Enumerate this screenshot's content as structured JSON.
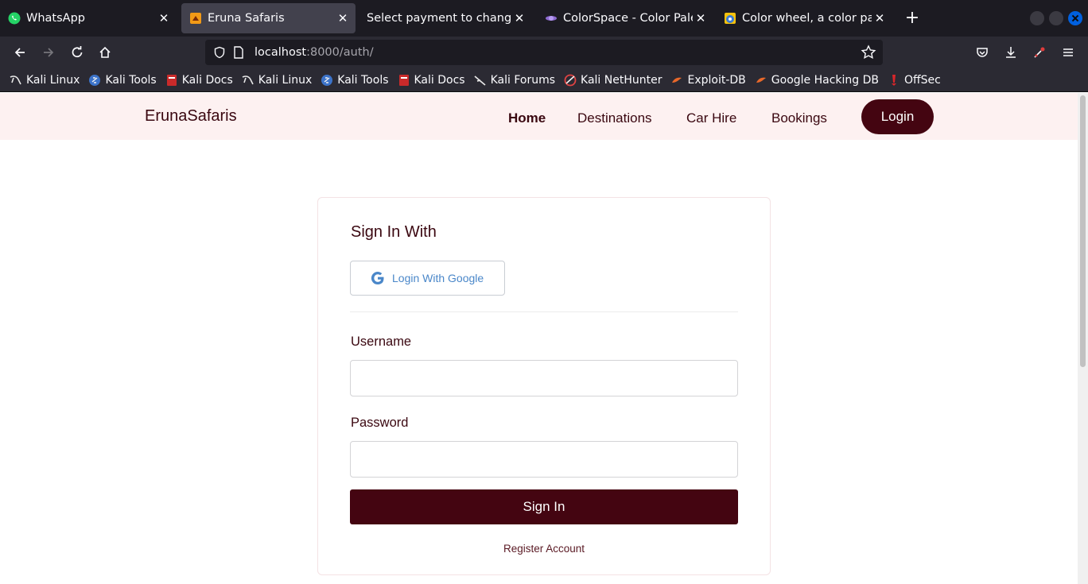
{
  "browser": {
    "tabs": [
      {
        "title": "WhatsApp",
        "icon": "whatsapp-icon",
        "active": false
      },
      {
        "title": "Eruna Safaris",
        "icon": "eruna-favicon",
        "active": true
      },
      {
        "title": "Select payment to change | D",
        "icon": "",
        "active": false
      },
      {
        "title": "ColorSpace - Color Palett",
        "icon": "colorspace-icon",
        "active": false
      },
      {
        "title": "Color wheel, a color palet",
        "icon": "color-wheel-icon",
        "active": false
      }
    ],
    "url": {
      "host": "localhost",
      "rest": ":8000/auth/"
    },
    "bookmarks": [
      {
        "label": "Kali Linux",
        "icon": "kali-dragon-icon"
      },
      {
        "label": "Kali Tools",
        "icon": "kali-tools-icon"
      },
      {
        "label": "Kali Docs",
        "icon": "kali-docs-icon"
      },
      {
        "label": "Kali Linux",
        "icon": "kali-dragon-icon"
      },
      {
        "label": "Kali Tools",
        "icon": "kali-tools-icon"
      },
      {
        "label": "Kali Docs",
        "icon": "kali-docs-icon"
      },
      {
        "label": "Kali Forums",
        "icon": "kali-dragon-icon"
      },
      {
        "label": "Kali NetHunter",
        "icon": "nethunter-icon"
      },
      {
        "label": "Exploit-DB",
        "icon": "exploit-db-icon"
      },
      {
        "label": "Google Hacking DB",
        "icon": "ghdb-icon"
      },
      {
        "label": "OffSec",
        "icon": "offsec-icon"
      }
    ]
  },
  "site": {
    "brand": "ErunaSafaris",
    "nav": {
      "home": "Home",
      "destinations": "Destinations",
      "car_hire": "Car Hire",
      "bookings": "Bookings",
      "login": "Login"
    }
  },
  "auth": {
    "title": "Sign In With",
    "google_button": "Login With Google",
    "username_label": "Username",
    "username_value": "",
    "password_label": "Password",
    "password_value": "",
    "submit": "Sign In",
    "register": "Register Account"
  },
  "colors": {
    "brand_dark": "#440511",
    "nav_background": "#fdf1f1",
    "google_text": "#4a87c9"
  }
}
